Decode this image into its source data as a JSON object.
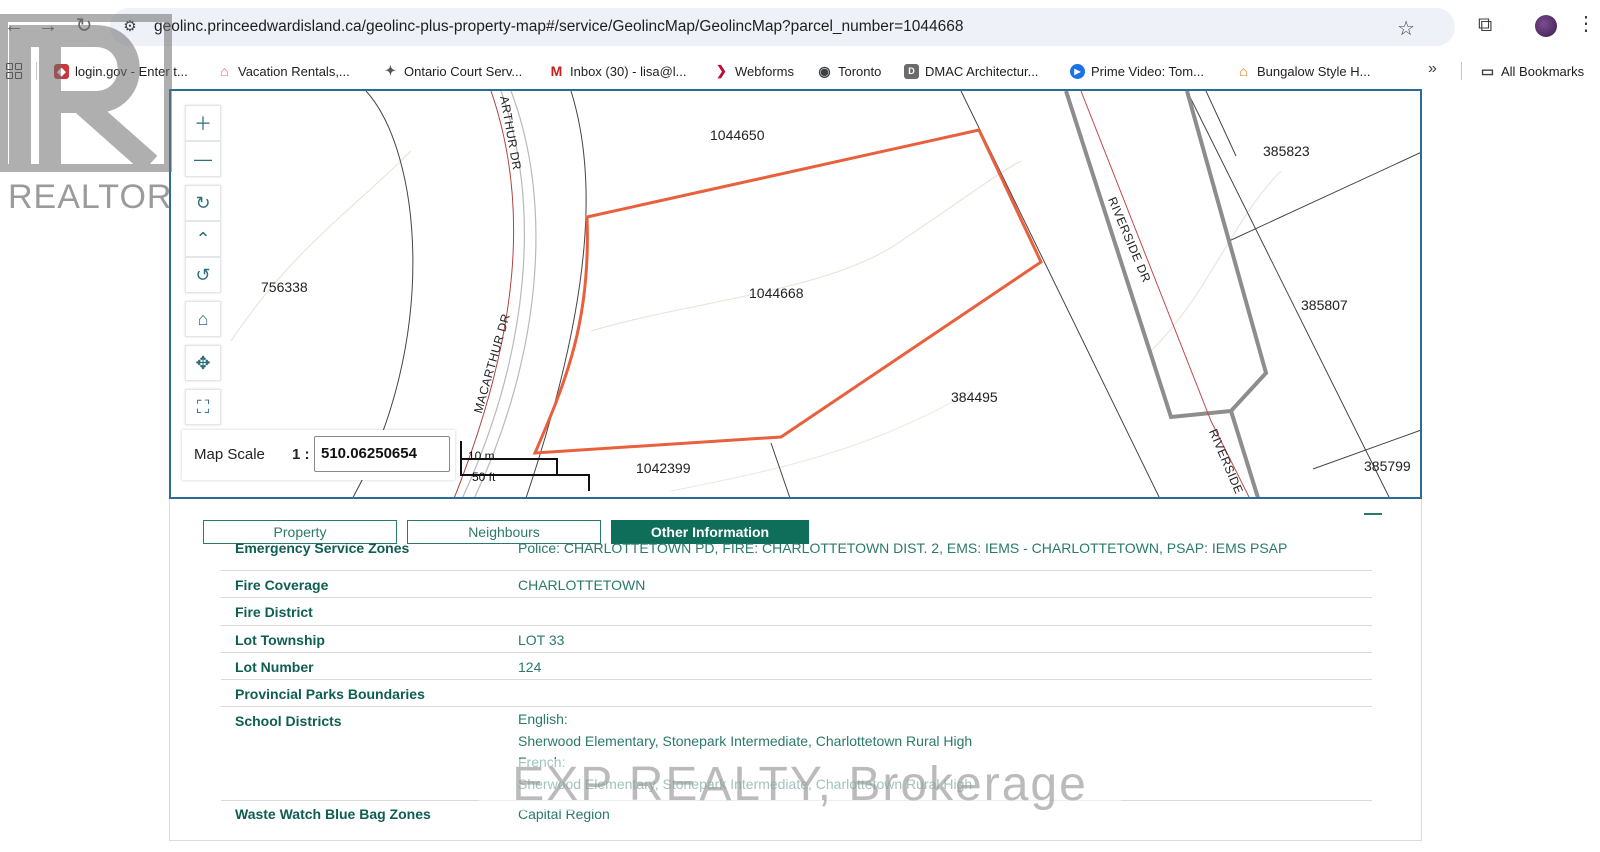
{
  "browser": {
    "url": "geolinc.princeedwardisland.ca/geolinc-plus-property-map#/service/GeolincMap/GeolincMap?parcel_number=1044668",
    "bookmarks": [
      {
        "label": "login.gov - Enter t...",
        "icon": "shield-icon",
        "color": "#c9373a"
      },
      {
        "label": "Vacation Rentals,...",
        "icon": "airbnb-icon",
        "color": "#ff5a5f"
      },
      {
        "label": "Ontario Court Serv...",
        "icon": "ontario-icon",
        "color": "#555555"
      },
      {
        "label": "Inbox (30) - lisa@l...",
        "icon": "gmail-icon",
        "color": "#c5221f"
      },
      {
        "label": "Webforms",
        "icon": "webforms-icon",
        "color": "#b3123d"
      },
      {
        "label": "Toronto",
        "icon": "globe-icon",
        "color": "#3c4043"
      },
      {
        "label": "DMAC Architectur...",
        "icon": "dmac-icon",
        "color": "#6b6b6b"
      },
      {
        "label": "Prime Video: Tom...",
        "icon": "prime-video-icon",
        "color": "#1a73e8"
      },
      {
        "label": "Bungalow Style H...",
        "icon": "house-icon",
        "color": "#e8710a"
      }
    ],
    "all_bookmarks": "All Bookmarks"
  },
  "watermarks": {
    "realtor": "REALTOR",
    "brokerage": "EXP REALTY, Brokerage"
  },
  "map": {
    "parcels": [
      "1044650",
      "385823",
      "756338",
      "1044668",
      "385807",
      "384495",
      "1042399",
      "385799"
    ],
    "roads": [
      "ARTHUR DR",
      "MACARTHUR DR",
      "RIVERSIDE DR",
      "RIVERSIDE"
    ],
    "scale_label": "Map Scale",
    "scale_prefix": "1 :",
    "scale_value": "510.06250654",
    "scalebar_metric": "10 m",
    "scalebar_imperial": "50 ft",
    "tools": [
      "zoom-in-icon",
      "zoom-out-icon",
      "rotate-icon",
      "north-arrow-icon",
      "reset-rotation-icon",
      "home-icon",
      "pan-icon",
      "fullscreen-icon"
    ]
  },
  "panel": {
    "tabs": [
      "Property",
      "Neighbours",
      "Other Information"
    ],
    "active_tab": "Other Information",
    "rows": [
      {
        "label": "Emergency Service Zones",
        "value": "Police: CHARLOTTETOWN PD, FIRE: CHARLOTTETOWN DIST. 2, EMS: IEMS - CHARLOTTETOWN, PSAP: IEMS PSAP"
      },
      {
        "label": "Fire Coverage",
        "value": "CHARLOTTETOWN"
      },
      {
        "label": "Fire District",
        "value": ""
      },
      {
        "label": "Lot Township",
        "value": "LOT 33"
      },
      {
        "label": "Lot Number",
        "value": "124"
      },
      {
        "label": "Provincial Parks Boundaries",
        "value": ""
      },
      {
        "label": "School Districts",
        "values": [
          "English:",
          "Sherwood Elementary, Stonepark Intermediate, Charlottetown Rural High",
          "French:",
          "Sherwood Elementary, Stonepark Intermediate, Charlottetown Rural High"
        ]
      },
      {
        "label": "Waste Watch Blue Bag Zones",
        "value": "Capital Region"
      }
    ]
  },
  "colors": {
    "parcel_highlight": "#e8603c",
    "map_border": "#2a6c97",
    "accent_green": "#0f6e5a"
  }
}
